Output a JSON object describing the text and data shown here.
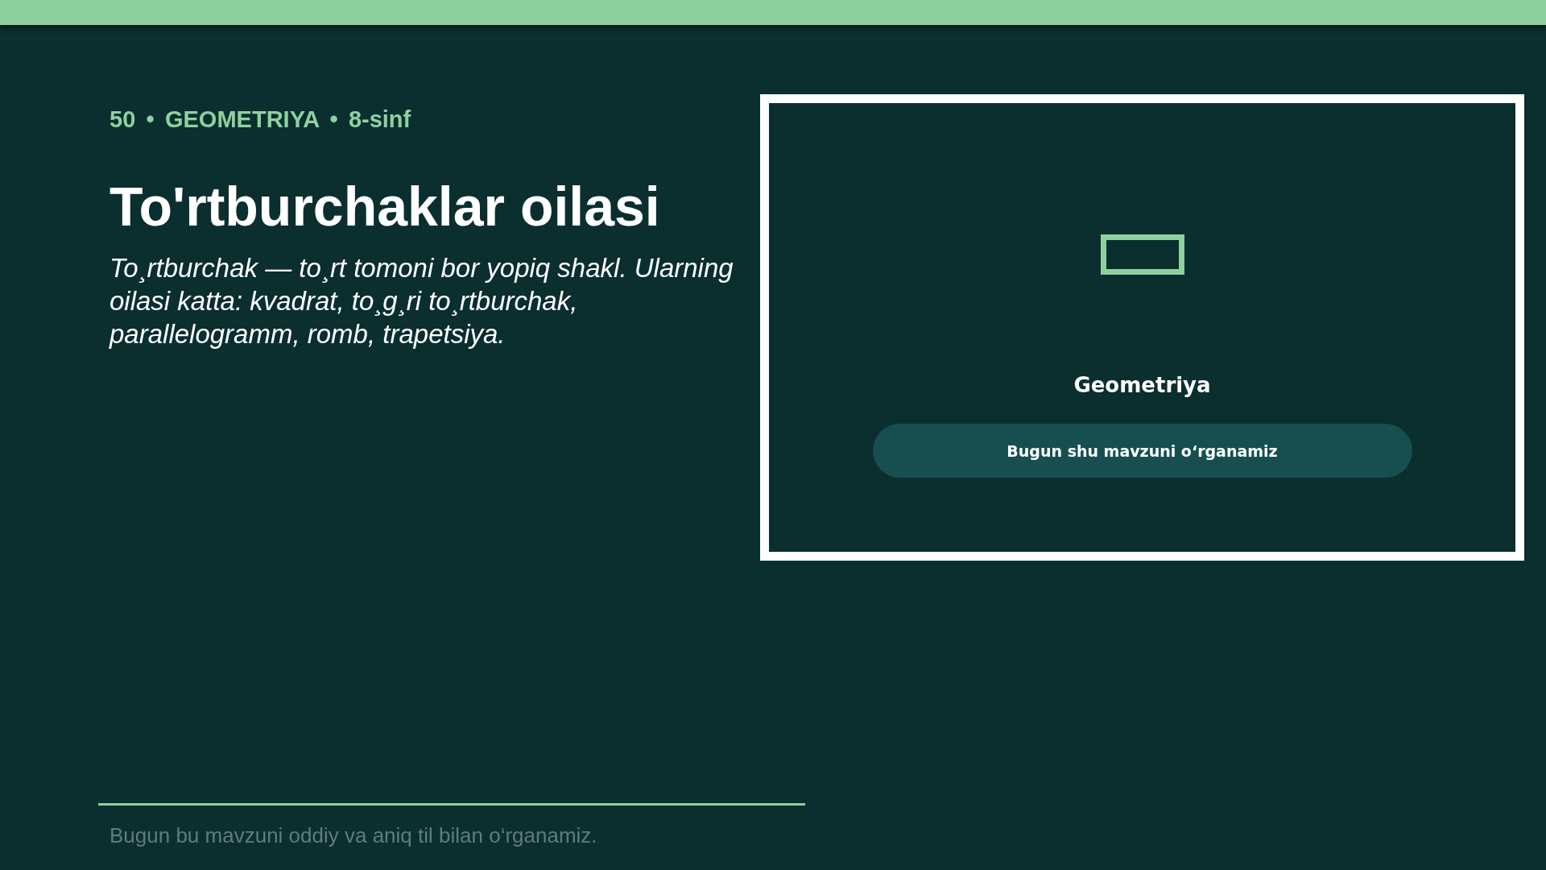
{
  "meta": "50 • GEOMETRIYA • 8-sinf",
  "title": "To'rtburchaklar oilasi",
  "description": "To¸rtburchak — to¸rt tomoni bor yopiq shakl. Ularning oilasi katta: kvadrat, to¸g¸ri to¸rtburchak, parallelogramm, romb, trapetsiya.",
  "card": {
    "label": "Geometriya",
    "button": "Bugun shu mavzuni o‘rganamiz"
  },
  "footer": {
    "text": "Bugun bu mavzuni oddiy va aniq til bilan o‘rganamiz."
  }
}
